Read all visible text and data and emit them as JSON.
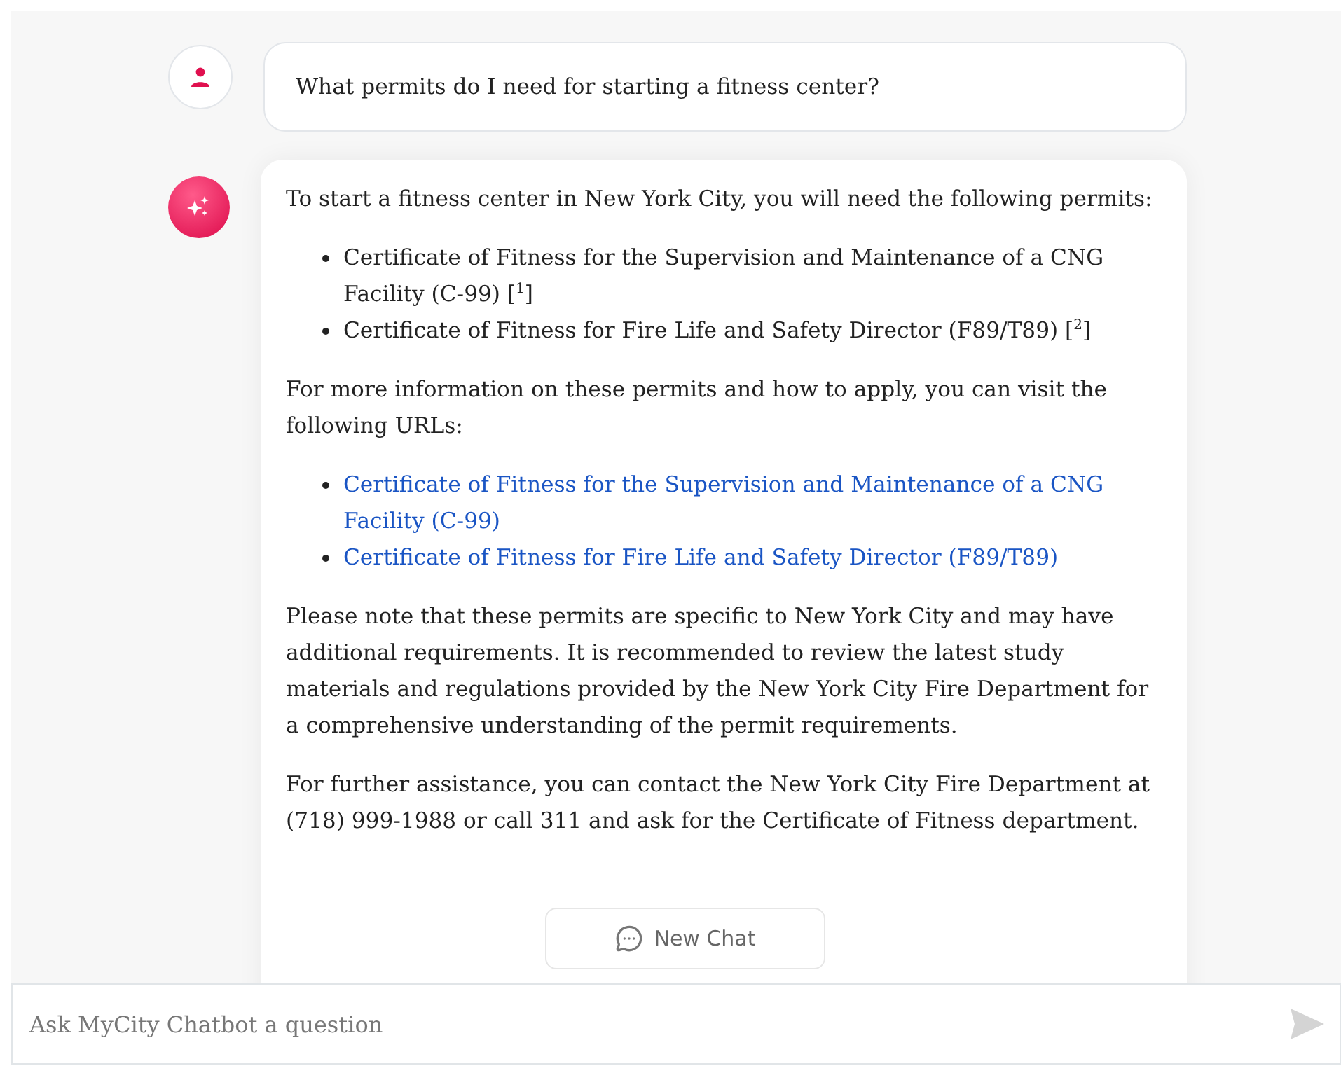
{
  "messages": [
    {
      "kind": "user",
      "text": "What permits do I need for starting a fitness center?"
    },
    {
      "kind": "bot",
      "blocks": [
        {
          "kind": "paragraph",
          "text": "To start a fitness center in New York City, you will need the following permits:"
        },
        {
          "kind": "list",
          "items": [
            {
              "kind": "text",
              "text": "Certificate of Fitness for the Supervision and Maintenance of a CNG Facility (C-99) [$^{1}$]"
            },
            {
              "kind": "text",
              "text": "Certificate of Fitness for Fire Life and Safety Director (F89/T89) [$^{2}$]"
            }
          ]
        },
        {
          "kind": "paragraph",
          "text": "For more information on these permits and how to apply, you can visit the following URLs:"
        },
        {
          "kind": "list",
          "items": [
            {
              "kind": "link",
              "text": "Certificate of Fitness for the Supervision and Maintenance of a CNG Facility (C-99)"
            },
            {
              "kind": "link",
              "text": "Certificate of Fitness for Fire Life and Safety Director (F89/T89)"
            }
          ]
        },
        {
          "kind": "paragraph",
          "text": "Please note that these permits are specific to New York City and may have additional requirements. It is recommended to review the latest study materials and regulations provided by the New York City Fire Department for a comprehensive understanding of the permit requirements."
        },
        {
          "kind": "paragraph",
          "text": "For further assistance, you can contact the New York City Fire Department at (718) 999-1988 or call 311 and ask for the Certificate of Fitness department."
        }
      ]
    }
  ],
  "new_chat_button": {
    "label": "New Chat"
  },
  "input": {
    "placeholder": "Ask MyCity Chatbot a question"
  }
}
